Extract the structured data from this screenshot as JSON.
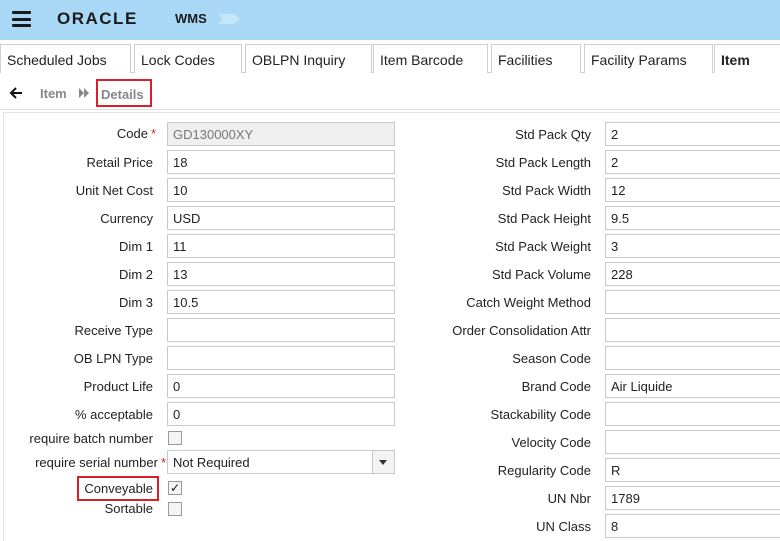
{
  "header": {
    "brand": "ORACLE",
    "app_name": "WMS"
  },
  "tabs": [
    {
      "label": "Scheduled Jobs"
    },
    {
      "label": "Lock Codes"
    },
    {
      "label": "OBLPN Inquiry"
    },
    {
      "label": "Item Barcode"
    },
    {
      "label": "Facilities"
    },
    {
      "label": "Facility Params"
    },
    {
      "label": "Item"
    }
  ],
  "breadcrumb": {
    "parent": "Item",
    "current": "Details"
  },
  "left_fields": {
    "code": {
      "label": "Code",
      "value": "GD130000XY"
    },
    "retail_price": {
      "label": "Retail Price",
      "value": "18"
    },
    "unit_net_cost": {
      "label": "Unit Net Cost",
      "value": "10"
    },
    "currency": {
      "label": "Currency",
      "value": "USD"
    },
    "dim1": {
      "label": "Dim 1",
      "value": "11"
    },
    "dim2": {
      "label": "Dim 2",
      "value": "13"
    },
    "dim3": {
      "label": "Dim 3",
      "value": "10.5"
    },
    "receive_type": {
      "label": "Receive Type",
      "value": ""
    },
    "ob_lpn_type": {
      "label": "OB LPN Type",
      "value": ""
    },
    "product_life": {
      "label": "Product Life",
      "value": "0"
    },
    "pct_acceptable": {
      "label": "% acceptable",
      "value": "0"
    },
    "require_batch": {
      "label": "require batch number",
      "checked": false
    },
    "require_serial": {
      "label": "require serial number",
      "value": "Not Required"
    },
    "conveyable": {
      "label": "Conveyable",
      "checked": true,
      "check_glyph": "✓"
    },
    "sortable": {
      "label": "Sortable",
      "checked": false
    }
  },
  "right_fields": {
    "std_pack_qty": {
      "label": "Std Pack Qty",
      "value": "2"
    },
    "std_pack_length": {
      "label": "Std Pack Length",
      "value": "2"
    },
    "std_pack_width": {
      "label": "Std Pack Width",
      "value": "12"
    },
    "std_pack_height": {
      "label": "Std Pack Height",
      "value": "9.5"
    },
    "std_pack_weight": {
      "label": "Std Pack Weight",
      "value": "3"
    },
    "std_pack_volume": {
      "label": "Std Pack Volume",
      "value": "228"
    },
    "catch_weight_method": {
      "label": "Catch Weight Method",
      "value": ""
    },
    "order_consolidation_attr": {
      "label": "Order Consolidation Attr",
      "value": ""
    },
    "season_code": {
      "label": "Season Code",
      "value": ""
    },
    "brand_code": {
      "label": "Brand Code",
      "value": "Air Liquide"
    },
    "stackability_code": {
      "label": "Stackability Code",
      "value": ""
    },
    "velocity_code": {
      "label": "Velocity Code",
      "value": ""
    },
    "regularity_code": {
      "label": "Regularity Code",
      "value": "R"
    },
    "un_nbr": {
      "label": "UN Nbr",
      "value": "1789"
    },
    "un_class": {
      "label": "UN Class",
      "value": "8"
    }
  },
  "colors": {
    "header_bg": "#a8d8f5",
    "required_mark": "#d8202c",
    "highlight_box": "#d8202c"
  }
}
